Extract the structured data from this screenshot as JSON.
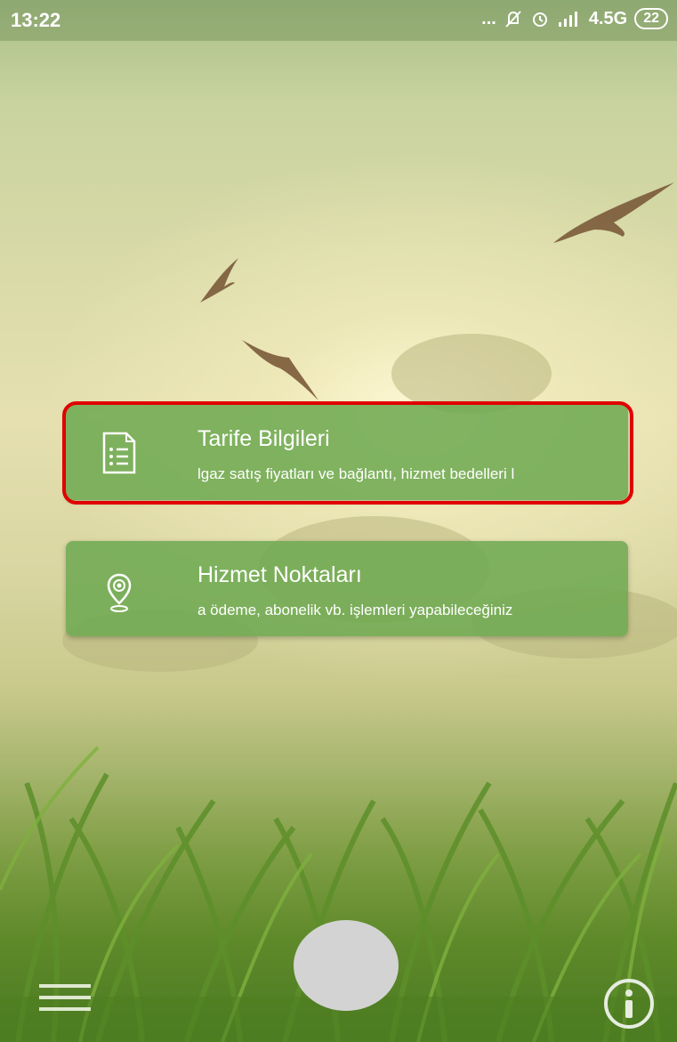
{
  "status_bar": {
    "time": "13:22",
    "dots": "...",
    "network": "4.5G",
    "battery": "22",
    "icons": [
      "mute-bell-icon",
      "alarm-icon",
      "signal-icon"
    ]
  },
  "cards": [
    {
      "title": "Tarife Bilgileri",
      "subtitle": "lgaz satış fiyatları ve bağlantı, hizmet bedelleri l",
      "icon": "document-list-icon"
    },
    {
      "title": "Hizmet Noktaları",
      "subtitle": "a ödeme, abonelik vb. işlemleri yapabileceğiniz",
      "icon": "location-pin-icon"
    }
  ],
  "bottom_bar": {
    "menu_icon": "hamburger-menu-icon",
    "info_icon": "info-icon"
  },
  "colors": {
    "card_bg": "#70aa52",
    "highlight": "#e00000",
    "center_button": "#d3d3d3"
  }
}
